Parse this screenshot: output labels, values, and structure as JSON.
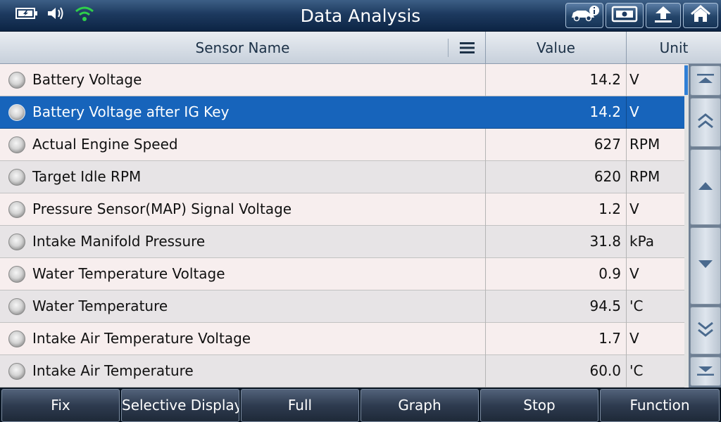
{
  "header": {
    "title": "Data Analysis"
  },
  "status_icons": [
    "battery-charging-icon",
    "speaker-icon",
    "wifi-icon"
  ],
  "header_buttons": [
    "vehicle-info-icon",
    "screenshot-icon",
    "back-up-icon",
    "home-icon"
  ],
  "table": {
    "columns": {
      "name": "Sensor Name",
      "value": "Value",
      "unit": "Unit"
    },
    "selected_index": 1,
    "rows": [
      {
        "name": "Battery Voltage",
        "value": "14.2",
        "unit": "V"
      },
      {
        "name": "Battery Voltage after IG Key",
        "value": "14.2",
        "unit": "V"
      },
      {
        "name": "Actual Engine Speed",
        "value": "627",
        "unit": "RPM"
      },
      {
        "name": "Target Idle RPM",
        "value": "620",
        "unit": "RPM"
      },
      {
        "name": "Pressure Sensor(MAP) Signal Voltage",
        "value": "1.2",
        "unit": "V"
      },
      {
        "name": "Intake Manifold Pressure",
        "value": "31.8",
        "unit": "kPa"
      },
      {
        "name": "Water Temperature Voltage",
        "value": "0.9",
        "unit": "V"
      },
      {
        "name": "Water Temperature",
        "value": "94.5",
        "unit": "'C"
      },
      {
        "name": "Intake Air Temperature Voltage",
        "value": "1.7",
        "unit": "V"
      },
      {
        "name": "Intake Air Temperature",
        "value": "60.0",
        "unit": "'C"
      }
    ]
  },
  "scroll_buttons": [
    "scroll-top-icon",
    "page-up-icon",
    "scroll-up-icon",
    "scroll-down-icon",
    "page-down-icon",
    "scroll-bottom-icon"
  ],
  "footer": {
    "buttons": [
      "Fix",
      "Selective Display",
      "Full",
      "Graph",
      "Stop",
      "Function"
    ]
  },
  "colors": {
    "selected_row": "#1764bb",
    "title_bar": "#1d3a5f",
    "wifi": "#2fd04a"
  }
}
